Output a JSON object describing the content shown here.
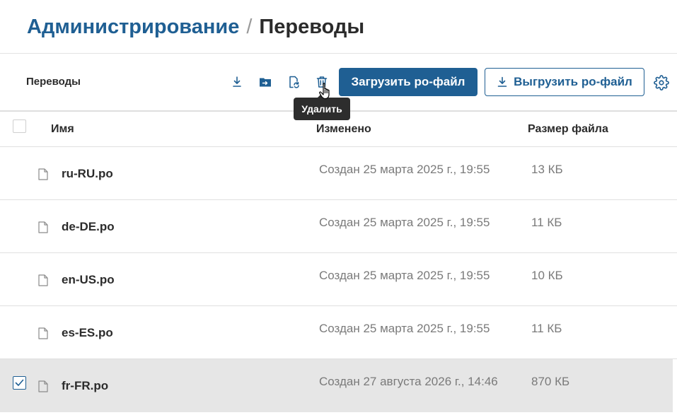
{
  "breadcrumb": {
    "parent": "Администрирование",
    "separator": "/",
    "current": "Переводы"
  },
  "toolbar": {
    "title": "Переводы",
    "upload_button": "Загрузить po-файл",
    "download_button": "Выгрузить po-файл",
    "tooltip": "Удалить",
    "icons": [
      "download-icon",
      "move-to-folder-icon",
      "replace-file-icon",
      "trash-icon",
      "gear-icon"
    ]
  },
  "table": {
    "columns": {
      "name": "Имя",
      "modified": "Изменено",
      "size": "Размер файла"
    },
    "rows": [
      {
        "name": "ru-RU.po",
        "modified": "Создан 25 марта 2025 г., 19:55",
        "size": "13 КБ",
        "selected": false
      },
      {
        "name": "de-DE.po",
        "modified": "Создан 25 марта 2025 г., 19:55",
        "size": "11 КБ",
        "selected": false
      },
      {
        "name": "en-US.po",
        "modified": "Создан 25 марта 2025 г., 19:55",
        "size": "10 КБ",
        "selected": false
      },
      {
        "name": "es-ES.po",
        "modified": "Создан 25 марта 2025 г., 19:55",
        "size": "11 КБ",
        "selected": false
      },
      {
        "name": "fr-FR.po",
        "modified": "Создан 27 августа 2026 г., 14:46",
        "size": "870 КБ",
        "selected": true
      }
    ]
  },
  "colors": {
    "accent": "#1f5f93",
    "selected_row": "#e6e6e6",
    "muted_text": "#7a7a7a"
  }
}
